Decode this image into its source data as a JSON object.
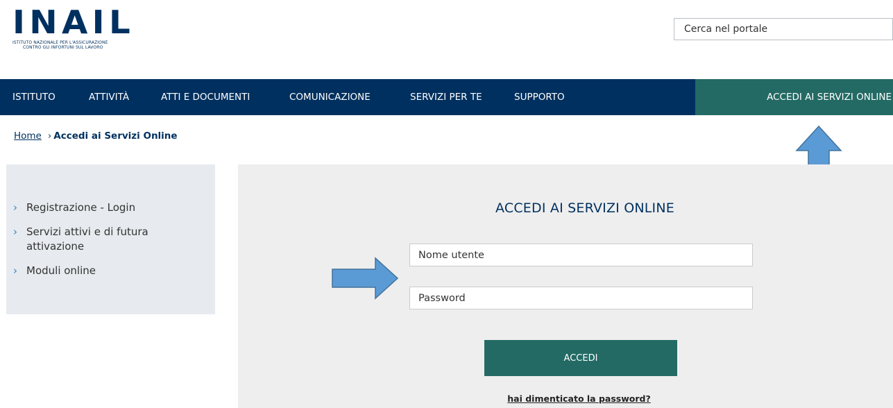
{
  "logo": {
    "wordmark": "INAIL",
    "subtitle_line1": "ISTITUTO NAZIONALE PER L'ASSICURAZIONE",
    "subtitle_line2": "CONTRO GLI INFORTUNI SUL LAVORO"
  },
  "search": {
    "placeholder": "Cerca nel portale"
  },
  "nav": {
    "items": [
      "ISTITUTO",
      "ATTIVITÀ",
      "ATTI E DOCUMENTI",
      "COMUNICAZIONE",
      "SERVIZI PER TE",
      "SUPPORTO"
    ],
    "access_label": "ACCEDI AI SERVIZI ONLINE"
  },
  "breadcrumb": {
    "home": "Home",
    "separator": "›",
    "current": "Accedi ai Servizi Online"
  },
  "sidebar": {
    "items": [
      {
        "label": "Registrazione - Login"
      },
      {
        "label": "Servizi attivi e di futura attivazione"
      },
      {
        "label": "Moduli online"
      }
    ]
  },
  "login": {
    "title": "ACCEDI AI SERVIZI ONLINE",
    "username_placeholder": "Nome utente",
    "password_placeholder": "Password",
    "submit_label": "ACCEDI",
    "forgot_link": "hai dimenticato la password?"
  },
  "colors": {
    "brand_blue": "#00305f",
    "accent_green": "#236a64",
    "sidebar_bg": "#e7eaee",
    "panel_bg": "#eeeeee",
    "annotation_arrow": "#5b9bd5"
  }
}
